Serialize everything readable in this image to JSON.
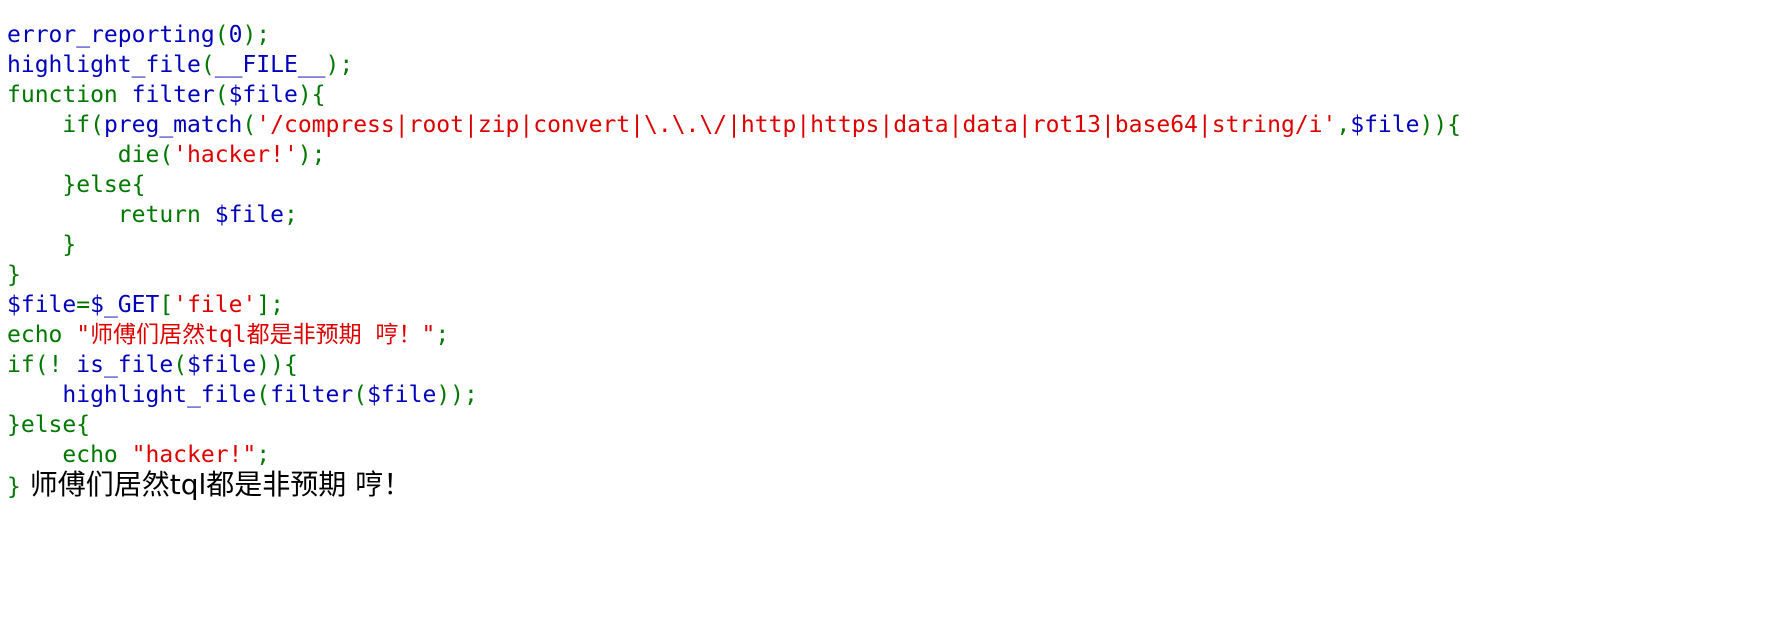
{
  "code": {
    "lines": [
      {
        "tokens": [
          {
            "t": "error_reporting",
            "c": "f"
          },
          {
            "t": "(",
            "c": "d"
          },
          {
            "t": "0",
            "c": "f"
          },
          {
            "t": ");",
            "c": "d"
          }
        ]
      },
      {
        "tokens": [
          {
            "t": "highlight_file",
            "c": "f"
          },
          {
            "t": "(",
            "c": "d"
          },
          {
            "t": "__FILE__",
            "c": "f"
          },
          {
            "t": ");",
            "c": "d"
          }
        ]
      },
      {
        "tokens": [
          {
            "t": "function ",
            "c": "d"
          },
          {
            "t": "filter",
            "c": "f"
          },
          {
            "t": "(",
            "c": "d"
          },
          {
            "t": "$file",
            "c": "f"
          },
          {
            "t": "){",
            "c": "d"
          }
        ]
      },
      {
        "tokens": [
          {
            "t": "    if(",
            "c": "d"
          },
          {
            "t": "preg_match",
            "c": "f"
          },
          {
            "t": "(",
            "c": "d"
          },
          {
            "t": "'/compress|root|zip|convert|\\.\\.\\/|http|https|data|data|rot13|base64|string/i'",
            "c": "s"
          },
          {
            "t": ",",
            "c": "d"
          },
          {
            "t": "$file",
            "c": "f"
          },
          {
            "t": ")){",
            "c": "d"
          }
        ]
      },
      {
        "tokens": [
          {
            "t": "        die(",
            "c": "d"
          },
          {
            "t": "'hacker!'",
            "c": "s"
          },
          {
            "t": ");",
            "c": "d"
          }
        ]
      },
      {
        "tokens": [
          {
            "t": "    }else{",
            "c": "d"
          }
        ]
      },
      {
        "tokens": [
          {
            "t": "        return ",
            "c": "d"
          },
          {
            "t": "$file",
            "c": "f"
          },
          {
            "t": ";",
            "c": "d"
          }
        ]
      },
      {
        "tokens": [
          {
            "t": "    }",
            "c": "d"
          }
        ]
      },
      {
        "tokens": [
          {
            "t": "}",
            "c": "d"
          }
        ]
      },
      {
        "tokens": [
          {
            "t": "$file",
            "c": "f"
          },
          {
            "t": "=",
            "c": "d"
          },
          {
            "t": "$_GET",
            "c": "f"
          },
          {
            "t": "[",
            "c": "d"
          },
          {
            "t": "'file'",
            "c": "s"
          },
          {
            "t": "];",
            "c": "d"
          }
        ]
      },
      {
        "tokens": [
          {
            "t": "echo ",
            "c": "d"
          },
          {
            "t": "\"师傅们居然tql都是非预期 哼！\"",
            "c": "s"
          },
          {
            "t": ";",
            "c": "d"
          }
        ]
      },
      {
        "tokens": [
          {
            "t": "if(! ",
            "c": "d"
          },
          {
            "t": "is_file",
            "c": "f"
          },
          {
            "t": "(",
            "c": "d"
          },
          {
            "t": "$file",
            "c": "f"
          },
          {
            "t": ")){",
            "c": "d"
          }
        ]
      },
      {
        "tokens": [
          {
            "t": "    ",
            "c": "d"
          },
          {
            "t": "highlight_file",
            "c": "f"
          },
          {
            "t": "(",
            "c": "d"
          },
          {
            "t": "filter",
            "c": "f"
          },
          {
            "t": "(",
            "c": "d"
          },
          {
            "t": "$file",
            "c": "f"
          },
          {
            "t": "));",
            "c": "d"
          }
        ]
      },
      {
        "tokens": [
          {
            "t": "}else{",
            "c": "d"
          }
        ]
      },
      {
        "tokens": [
          {
            "t": "    echo ",
            "c": "d"
          },
          {
            "t": "\"hacker!\"",
            "c": "s"
          },
          {
            "t": ";",
            "c": "d"
          }
        ]
      },
      {
        "tokens": [
          {
            "t": "}",
            "c": "d"
          }
        ],
        "output": " 师傅们居然tql都是非预期 哼！"
      }
    ]
  },
  "colors": {
    "default": "#007700",
    "function": "#0000bb",
    "string": "#dd0000",
    "output_text": "#000000",
    "background": "#ffffff"
  }
}
